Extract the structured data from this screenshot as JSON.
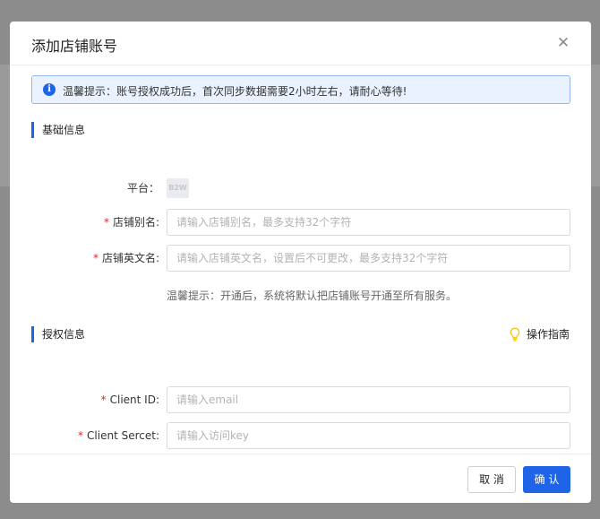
{
  "dialog": {
    "title": "添加店铺账号",
    "close_glyph": "✕"
  },
  "alert": {
    "icon": "info-icon",
    "icon_glyph": "i",
    "text": "温馨提示：账号授权成功后，首次同步数据需要2小时左右，请耐心等待!"
  },
  "basic_section": {
    "title": "基础信息",
    "platform": {
      "label": "平台：",
      "value": "B2W"
    },
    "shop_alias": {
      "required_mark": "*",
      "label": "店铺别名:",
      "value": "",
      "placeholder": "请输入店铺别名，最多支持32个字符"
    },
    "shop_english_name": {
      "required_mark": "*",
      "label": "店铺英文名:",
      "value": "",
      "placeholder": "请输入店铺英文名，设置后不可更改，最多支持32个字符"
    },
    "hint": "温馨提示：开通后，系统将默认把店铺账号开通至所有服务。"
  },
  "auth_section": {
    "title": "授权信息",
    "guide_label": "操作指南",
    "guide_icon": "lightbulb-icon",
    "client_id": {
      "required_mark": "*",
      "label": "Client ID:",
      "value": "",
      "placeholder": "请输入email"
    },
    "client_secret": {
      "required_mark": "*",
      "label": "Client Sercet:",
      "value": "",
      "placeholder": "请输入访问key"
    }
  },
  "footer": {
    "cancel_label": "取 消",
    "confirm_label": "确 认"
  },
  "colors": {
    "primary": "#1f64e6",
    "required": "#e02424",
    "alert_bg": "#eaf2ff",
    "alert_border": "#92b7f0",
    "guide_icon": "#f5c518"
  }
}
